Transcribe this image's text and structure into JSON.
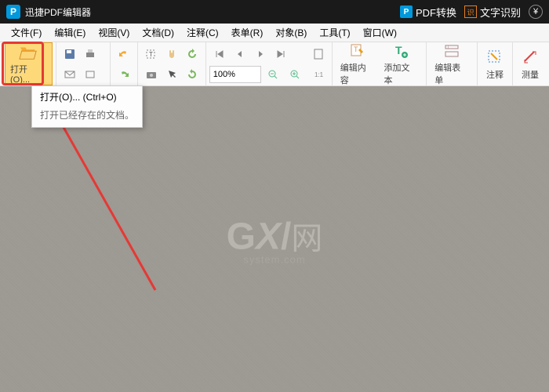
{
  "titlebar": {
    "logo": "P",
    "title": "迅捷PDF编辑器",
    "pdf_convert": "PDF转换",
    "ocr": "文字识别",
    "cny": "¥"
  },
  "menu": {
    "file": "文件(F)",
    "edit": "编辑(E)",
    "view": "视图(V)",
    "doc": "文档(D)",
    "comment": "注释(C)",
    "form": "表单(R)",
    "object": "对象(B)",
    "tools": "工具(T)",
    "window": "窗口(W)"
  },
  "toolbar": {
    "open": "打开(O)...",
    "zoom": "100%",
    "edit_content": "编辑内容",
    "add_text": "添加文本",
    "edit_form": "编辑表单",
    "annotate": "注释",
    "measure": "测量"
  },
  "tooltip": {
    "title": "打开(O)... (Ctrl+O)",
    "desc": "打开已经存在的文档。"
  },
  "watermark": {
    "g": "G",
    "x": "X",
    "slash": "/",
    "cn": "网",
    "sub": "system.com"
  }
}
